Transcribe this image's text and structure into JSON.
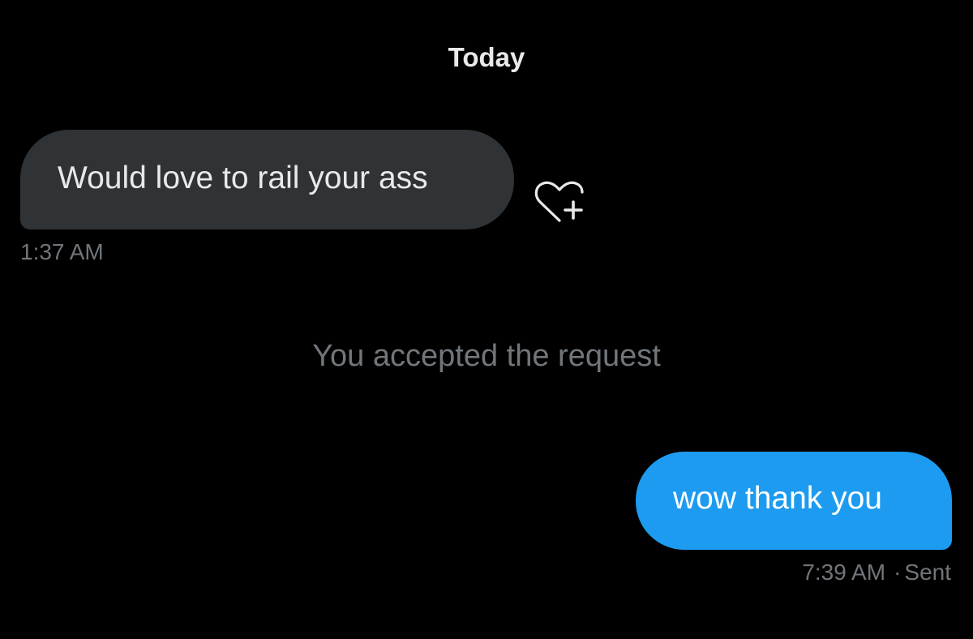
{
  "conversation": {
    "date_divider": "Today",
    "messages": [
      {
        "direction": "received",
        "text": "Would love to rail your ass",
        "time": "1:37 AM"
      },
      {
        "direction": "sent",
        "text": "wow thank you",
        "time": "7:39 AM",
        "separator": "·",
        "status": "Sent"
      }
    ],
    "system_notice": "You accepted the request",
    "reaction_icon": "heart-plus-icon"
  },
  "colors": {
    "background": "#000000",
    "received_bubble": "#2f3336",
    "sent_bubble": "#1d9bf0",
    "muted_text": "#71767b"
  }
}
